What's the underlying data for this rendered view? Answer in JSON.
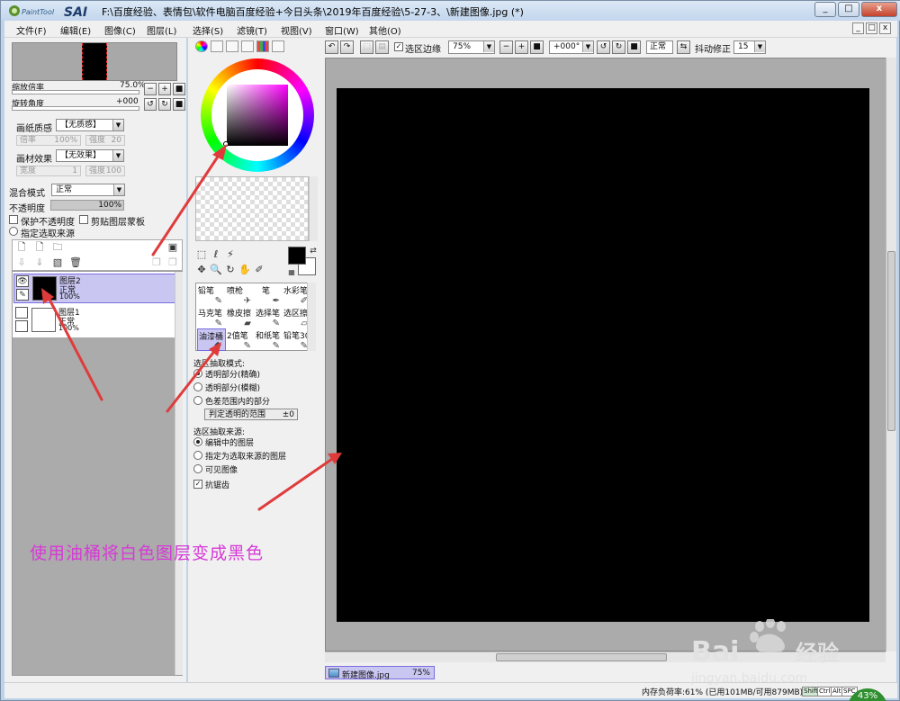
{
  "titlebar": {
    "title": "F:\\百度经验、表情包\\软件电脑百度经验+今日头条\\2019年百度经验\\5-27-3、\\新建图像.jpg (*)",
    "logo_small": "PaintTool",
    "logo_big": "SAI",
    "minimize": "_",
    "maximize": "□",
    "close": "x"
  },
  "menu": {
    "items": [
      "文件(F)",
      "编辑(E)",
      "图像(C)",
      "图层(L)",
      "选择(S)",
      "滤镜(T)",
      "视图(V)",
      "窗口(W)",
      "其他(O)"
    ],
    "mdi_min": "_",
    "mdi_max": "□",
    "mdi_close": "x"
  },
  "navigator": {
    "zoom_label": "缩放倍率",
    "zoom_value": "75.0%",
    "rotate_label": "旋转角度",
    "rotate_value": "+000"
  },
  "paper": {
    "texture_label": "画纸质感",
    "texture_value": "【无质感】",
    "scale_label": "倍率",
    "scale_value": "100%",
    "strength_label": "强度",
    "strength_value": "20",
    "effect_label": "画材效果",
    "effect_value": "【无效果】",
    "width_label": "宽度",
    "width_value": "1",
    "effect_strength_label": "强度",
    "effect_strength_value": "100"
  },
  "blend": {
    "mode_label": "混合模式",
    "mode_value": "正常",
    "opacity_label": "不透明度",
    "opacity_value": "100%",
    "protect_label": "保护不透明度",
    "clip_label": "剪贴图层蒙板",
    "source_label": "指定选取来源"
  },
  "layers": [
    {
      "name": "图层2",
      "mode": "正常",
      "opacity": "100%",
      "color": "#000000",
      "selected": true
    },
    {
      "name": "图层1",
      "mode": "正常",
      "opacity": "100%",
      "color": "#ffffff",
      "selected": false
    }
  ],
  "color_panel": {
    "hue_color": "#ff00ff",
    "foreground": "#000000",
    "background": "#ffffff"
  },
  "tools": [
    {
      "label": "铅笔",
      "icon": "pencil-icon",
      "glyph": "✎"
    },
    {
      "label": "喷枪",
      "icon": "airbrush-icon",
      "glyph": "✈"
    },
    {
      "label": "笔",
      "icon": "pen-icon",
      "glyph": "✒"
    },
    {
      "label": "水彩笔",
      "icon": "watercolor-icon",
      "glyph": "✐"
    },
    {
      "label": "马克笔",
      "icon": "marker-icon",
      "glyph": "✎"
    },
    {
      "label": "橡皮擦",
      "icon": "eraser-icon",
      "glyph": "▰"
    },
    {
      "label": "选择笔",
      "icon": "select-pen-icon",
      "glyph": "✎"
    },
    {
      "label": "选区擦",
      "icon": "select-eraser-icon",
      "glyph": "▱"
    },
    {
      "label": "油漆桶",
      "icon": "bucket-icon",
      "glyph": "◆",
      "selected": true
    },
    {
      "label": "2值笔",
      "icon": "binary-pen-icon",
      "glyph": "✎"
    },
    {
      "label": "和纸笔",
      "icon": "washi-pen-icon",
      "glyph": "✎"
    },
    {
      "label": "铅笔30",
      "icon": "pencil30-icon",
      "glyph": "✎"
    }
  ],
  "bucket_options": {
    "mode_title": "选区抽取模式:",
    "mode_options": [
      "透明部分(精确)",
      "透明部分(模糊)",
      "色差范围内的部分"
    ],
    "mode_selected": 0,
    "range_label": "判定透明的范围",
    "range_value": "±0",
    "source_title": "选区抽取来源:",
    "source_options": [
      "编辑中的图层",
      "指定为选取来源的图层",
      "可见图像"
    ],
    "source_selected": 0,
    "antialias_label": "抗锯齿"
  },
  "canvas_toolbar": {
    "selection_edge_label": "选区边缘",
    "zoom_value": "75%",
    "angle_value": "+000°",
    "mode_value": "正常",
    "stabilizer_label": "抖动修正",
    "stabilizer_value": "15"
  },
  "canvas": {
    "fill_color": "#000000",
    "tab_name": "新建图像.jpg",
    "tab_zoom": "75%"
  },
  "statusbar": {
    "memory_text": "内存负荷率:61% (已用101MB/可用879MB)",
    "keys": [
      "Shift",
      "Ctrl",
      "Alt",
      "SPC"
    ]
  },
  "annotation": {
    "text": "使用油桶将白色图层变成黑色",
    "color": "#d63ad6"
  },
  "watermark": {
    "brand_left": "Bai",
    "brand_right": "经验",
    "url": "jingyan.baidu.com"
  },
  "badge": {
    "value": "43%"
  }
}
